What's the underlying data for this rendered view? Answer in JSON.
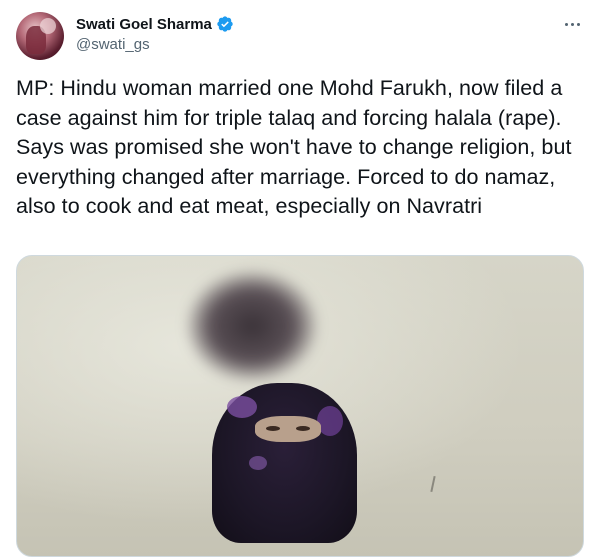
{
  "author": {
    "display_name": "Swati Goel Sharma",
    "handle": "@swati_gs",
    "verified": true
  },
  "icons": {
    "verified": "verified-badge-icon",
    "more": "more-options-icon"
  },
  "colors": {
    "verified_badge": "#1d9bf0",
    "text_primary": "#0f1419",
    "text_secondary": "#536471"
  },
  "tweet": {
    "text": "MP: Hindu woman married one Mohd Farukh, now filed a case against him for triple talaq and forcing halala (rape). Says was promised she won't have to change religion, but everything changed after marriage. Forced to do namaz, also to cook and eat meat, especially on Navratri"
  }
}
